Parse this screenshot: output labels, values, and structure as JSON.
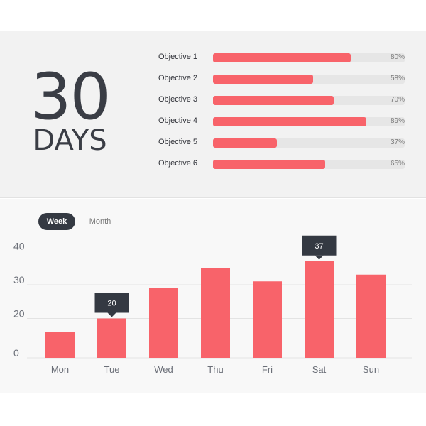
{
  "header": {
    "number": "30",
    "unit": "DAYS"
  },
  "objectives": [
    {
      "label": "Objective 1",
      "value": 80,
      "value_label": "80%"
    },
    {
      "label": "Objective 2",
      "value": 58,
      "value_label": "58%"
    },
    {
      "label": "Objective 3",
      "value": 70,
      "value_label": "70%"
    },
    {
      "label": "Objective 4",
      "value": 89,
      "value_label": "89%"
    },
    {
      "label": "Objective 5",
      "value": 37,
      "value_label": "37%"
    },
    {
      "label": "Objective 6",
      "value": 65,
      "value_label": "65%"
    }
  ],
  "tabs": {
    "week": "Week",
    "month": "Month",
    "active": "week"
  },
  "colors": {
    "accent": "#f8636a",
    "dark": "#343942",
    "track": "#e6e6e6"
  },
  "chart_data": {
    "type": "bar",
    "categories": [
      "Mon",
      "Tue",
      "Wed",
      "Thu",
      "Fri",
      "Sat",
      "Sun"
    ],
    "values": [
      16,
      20,
      29,
      35,
      31,
      37,
      33
    ],
    "yticks": [
      0,
      20,
      30,
      40
    ],
    "ylim": [
      0,
      40
    ],
    "grid": true,
    "tooltips": [
      {
        "category": "Tue",
        "text": "20"
      },
      {
        "category": "Sat",
        "text": "37"
      }
    ]
  }
}
